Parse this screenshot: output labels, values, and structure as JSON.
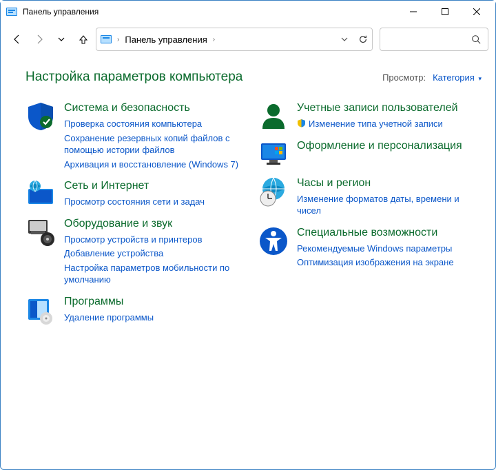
{
  "window": {
    "title": "Панель управления"
  },
  "breadcrumb": {
    "text": "Панель управления"
  },
  "heading": "Настройка параметров компьютера",
  "view": {
    "label": "Просмотр:",
    "value": "Категория"
  },
  "left_cats": [
    {
      "title": "Система и безопасность",
      "icon": "shield",
      "links": [
        {
          "text": "Проверка состояния компьютера"
        },
        {
          "text": "Сохранение резервных копий файлов с помощью истории файлов"
        },
        {
          "text": "Архивация и восстановление (Windows 7)"
        }
      ]
    },
    {
      "title": "Сеть и Интернет",
      "icon": "network",
      "links": [
        {
          "text": "Просмотр состояния сети и задач"
        }
      ]
    },
    {
      "title": "Оборудование и звук",
      "icon": "hardware",
      "links": [
        {
          "text": "Просмотр устройств и принтеров"
        },
        {
          "text": "Добавление устройства"
        },
        {
          "text": "Настройка параметров мобильности по умолчанию"
        }
      ]
    },
    {
      "title": "Программы",
      "icon": "programs",
      "links": [
        {
          "text": "Удаление программы"
        }
      ]
    }
  ],
  "right_cats": [
    {
      "title": "Учетные записи пользователей",
      "icon": "user",
      "links": [
        {
          "text": "Изменение типа учетной записи",
          "shield": true
        }
      ]
    },
    {
      "title": "Оформление и персонализация",
      "icon": "appearance",
      "links": []
    },
    {
      "title": "Часы и регион",
      "icon": "clock",
      "links": [
        {
          "text": "Изменение форматов даты, времени и чисел"
        }
      ]
    },
    {
      "title": "Специальные возможности",
      "icon": "access",
      "links": [
        {
          "text": "Рекомендуемые Windows параметры"
        },
        {
          "text": "Оптимизация изображения на экране"
        }
      ]
    }
  ]
}
